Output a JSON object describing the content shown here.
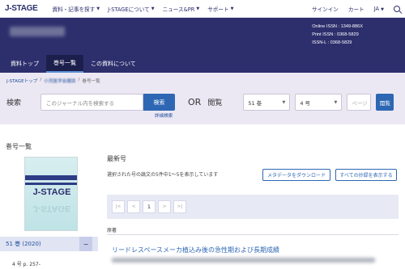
{
  "topnav": {
    "logo": "J-STAGE",
    "items": [
      "資料・記事を探す",
      "J-STAGEについて",
      "ニュース&PR",
      "サポート"
    ],
    "right": [
      "サインイン",
      "カート",
      "JA"
    ]
  },
  "header": {
    "issn": [
      "Online ISSN : 1349-886X",
      "Print ISSN : 0368-5829",
      "ISSN-L : 0368-5829"
    ]
  },
  "tabs": [
    "資料トップ",
    "巻号一覧",
    "この資料について"
  ],
  "breadcrumb": {
    "home": "J-STAGEトップ",
    "journal": "小児医学会雑誌",
    "current": "巻号一覧"
  },
  "search": {
    "label": "検索",
    "placeholder": "このジャーナル内を検索する",
    "button": "検索",
    "or": "OR",
    "browse_label": "閲覧",
    "volume": "51 巻",
    "number": "4 号",
    "page_placeholder": "ページ",
    "browse_button": "閲覧",
    "advanced": "詳細検索"
  },
  "sidebar": {
    "title": "巻号一覧",
    "cover_logo": "J-STAGE",
    "volume": "51 巻 (2020)",
    "toggle": "−",
    "sub_issue": "4 号 p. 257-"
  },
  "main": {
    "latest": "最新号",
    "info": "選択された号の論文の5件中1〜5を表示しています",
    "download_button": "メタデータをダウンロード",
    "show_all_button": "すべての抄録を表示する",
    "pager": [
      "|<",
      "<",
      "1",
      ">",
      ">|"
    ],
    "section": "原著",
    "article_title": "リードレスペースメーカ植込み後の急性期および長期成績"
  }
}
